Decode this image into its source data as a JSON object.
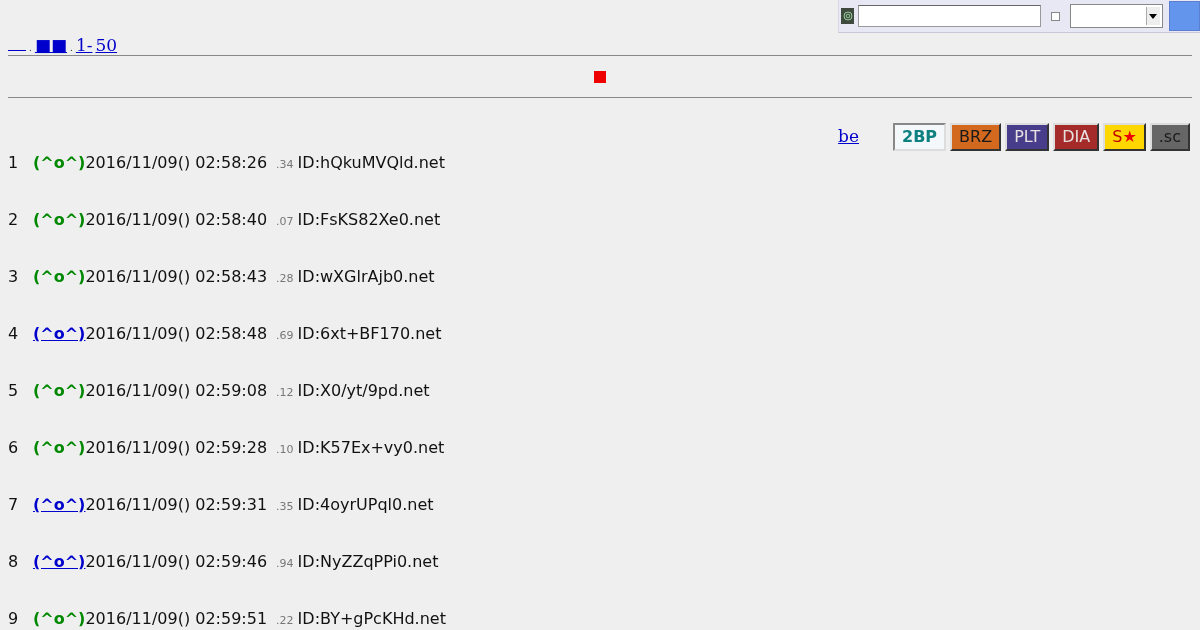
{
  "search_bar": {
    "checkbox": {
      "checked": false
    }
  },
  "nav_links": [
    {
      "kind": "blank"
    },
    {
      "kind": "sep",
      "text": "."
    },
    {
      "kind": "link",
      "text": "■■"
    },
    {
      "kind": "sep",
      "text": "."
    },
    {
      "kind": "link",
      "text": "1-"
    },
    {
      "kind": "link",
      "text": "50"
    }
  ],
  "be_link": "be",
  "tag_buttons": [
    {
      "label": "2BP",
      "selected": true,
      "color": "#f4f8fa"
    },
    {
      "label": "BRZ",
      "selected": false,
      "color": "#d2691e"
    },
    {
      "label": "PLT",
      "selected": false,
      "color": "#483d8b"
    },
    {
      "label": "DIA",
      "selected": false,
      "color": "#a52a2a"
    },
    {
      "label": "S",
      "suffix": "★",
      "selected": false,
      "color": "#ffd700"
    },
    {
      "label": ".sc",
      "selected": false,
      "color": "#666666"
    }
  ],
  "posts": [
    {
      "number": "1",
      "name": "(^o^)",
      "kind": "plain",
      "date": "2016/11/09() 02:58:26",
      "ms": ".34",
      "id": "ID:hQkuMVQld.net"
    },
    {
      "number": "2",
      "name": "(^o^)",
      "kind": "plain",
      "date": "2016/11/09() 02:58:40",
      "ms": ".07",
      "id": "ID:FsKS82Xe0.net"
    },
    {
      "number": "3",
      "name": "(^o^)",
      "kind": "plain",
      "date": "2016/11/09() 02:58:43",
      "ms": ".28",
      "id": "ID:wXGlrAjb0.net"
    },
    {
      "number": "4",
      "name": "(^o^)",
      "kind": "link",
      "date": "2016/11/09() 02:58:48",
      "ms": ".69",
      "id": "ID:6xt+BF170.net"
    },
    {
      "number": "5",
      "name": "(^o^)",
      "kind": "plain",
      "date": "2016/11/09() 02:59:08",
      "ms": ".12",
      "id": "ID:X0/yt/9pd.net"
    },
    {
      "number": "6",
      "name": "(^o^)",
      "kind": "plain",
      "date": "2016/11/09() 02:59:28",
      "ms": ".10",
      "id": "ID:K57Ex+vy0.net"
    },
    {
      "number": "7",
      "name": "(^o^)",
      "kind": "link",
      "date": "2016/11/09() 02:59:31",
      "ms": ".35",
      "id": "ID:4oyrUPql0.net"
    },
    {
      "number": "8",
      "name": "(^o^)",
      "kind": "link",
      "date": "2016/11/09() 02:59:46",
      "ms": ".94",
      "id": "ID:NyZZqPPi0.net"
    },
    {
      "number": "9",
      "name": "(^o^)",
      "kind": "plain",
      "date": "2016/11/09() 02:59:51",
      "ms": ".22",
      "id": "ID:BY+gPcKHd.net"
    }
  ]
}
